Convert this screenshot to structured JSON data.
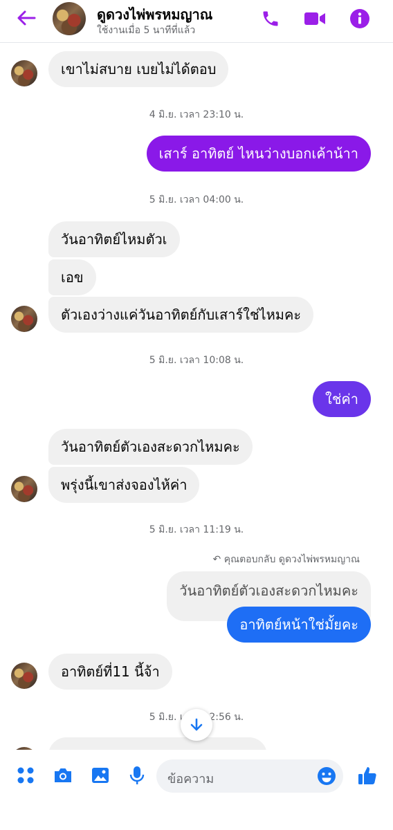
{
  "header": {
    "contact_name": "ดูดวงไพ่พรหมญาณ",
    "status": "ใช้งานเมื่อ 5 นาทีที่แล้ว"
  },
  "messages": {
    "m1": "เขาไม่สบาย เบยไม่ได้ตอบ",
    "ts1": "4 มิ.ย. เวลา 23:10 น.",
    "m2": "เสาร์ อาทิตย์ ไหนว่างบอกเค้าน้าา",
    "ts2": "5 มิ.ย. เวลา 04:00 น.",
    "m3": "วันอาทิตย์ไหมตัวเ",
    "m4": "เอข",
    "m5": "ตัวเองว่างแค่วันอาทิตย์กับเสาร์ใช่ไหมคะ",
    "ts3": "5 มิ.ย. เวลา 10:08 น.",
    "m6": "ใช่ค่า",
    "m7": "วันอาทิตย์ตัวเองสะดวกไหมคะ",
    "m8": "พรุ่งนี้เขาส่งจองไห้ค่า",
    "ts4": "5 มิ.ย. เวลา 11:19 น.",
    "reply_note": "คุณตอบกลับ ดูดวงไพ่พรหมญาณ",
    "quoted": "วันอาทิตย์ตัวเองสะดวกไหมคะ",
    "m9": "อาทิตย์หน้าใช่มั้ยคะ",
    "m10": "อาทิตย์ที่11 นี้จ้า",
    "ts5": "5 มิ.ย. เวลา 12:56 น."
  },
  "composer": {
    "placeholder": "ข้อความ"
  },
  "colors": {
    "accent_purple": "#8a19e8",
    "accent_violet": "#6a35ea",
    "accent_blue": "#1e6ef5",
    "icon_blue": "#1877f2",
    "incoming_bubble": "#f0f0f0"
  }
}
